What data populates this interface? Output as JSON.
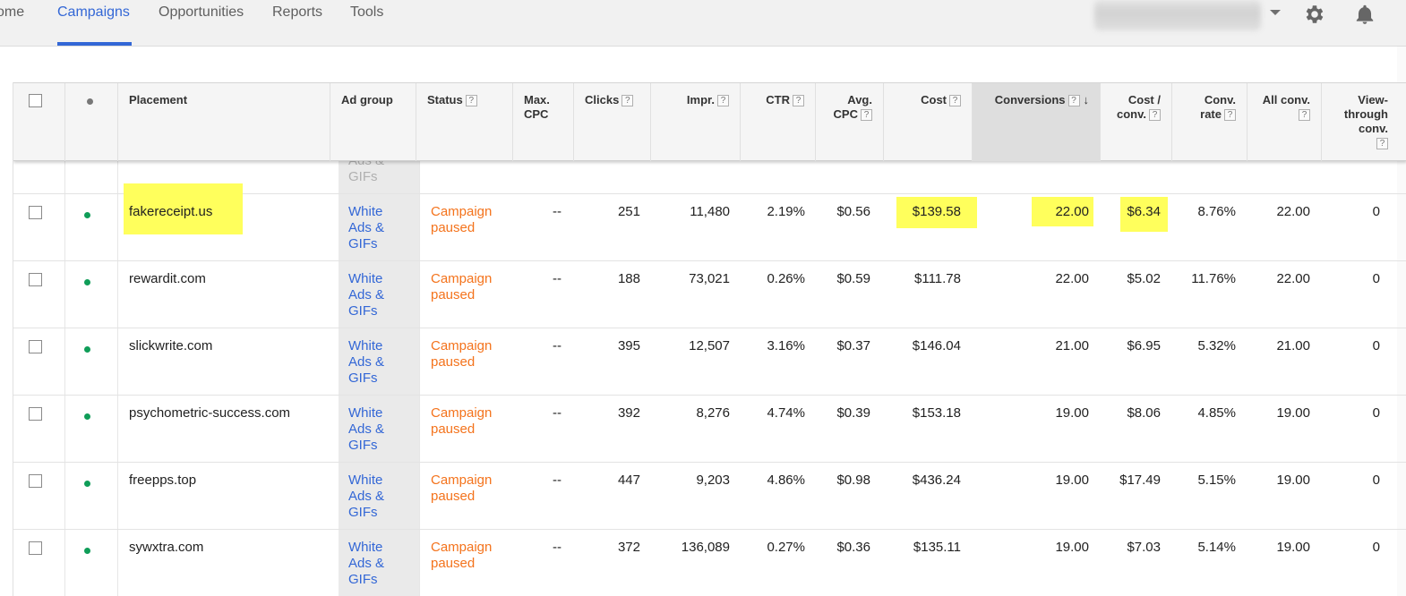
{
  "nav": {
    "items": [
      "ome",
      "Campaigns",
      "Opportunities",
      "Reports",
      "Tools"
    ],
    "active_index": 1
  },
  "icons": {
    "settings": "gear-icon",
    "notifications": "bell-icon",
    "account_menu": "caret-down-icon"
  },
  "colors": {
    "accent": "#3367d6",
    "status_paused": "#f4731c",
    "status_dot": "#0f9d58",
    "highlight": "#ffff5c"
  },
  "table": {
    "headers": {
      "placement": "Placement",
      "ad_group": "Ad group",
      "status": "Status",
      "max_cpc": [
        "Max.",
        "CPC"
      ],
      "clicks": "Clicks",
      "impr": "Impr.",
      "ctr": "CTR",
      "avg_cpc": [
        "Avg.",
        "CPC"
      ],
      "cost": "Cost",
      "conversions": "Conversions",
      "cost_per_conv": [
        "Cost /",
        "conv."
      ],
      "conv_rate": [
        "Conv.",
        "rate"
      ],
      "all_conv": "All conv.",
      "view_through": [
        "View-",
        "through",
        "conv."
      ]
    },
    "help_glyph": "?",
    "sort_glyph": "↓",
    "partial_row": [
      "Ads &",
      "GIFs"
    ],
    "rows": [
      {
        "placement": "fakereceipt.us",
        "ad_group": [
          "White",
          "Ads &",
          "GIFs"
        ],
        "status": [
          "Campaign",
          "paused"
        ],
        "max_cpc": "--",
        "clicks": "251",
        "impr": "11,480",
        "ctr": "2.19%",
        "avg_cpc": "$0.56",
        "cost": "$139.58",
        "conversions": "22.00",
        "cost_per_conv": "$6.34",
        "conv_rate": "8.76%",
        "all_conv": "22.00",
        "view_through": "0"
      },
      {
        "placement": "rewardit.com",
        "ad_group": [
          "White",
          "Ads &",
          "GIFs"
        ],
        "status": [
          "Campaign",
          "paused"
        ],
        "max_cpc": "--",
        "clicks": "188",
        "impr": "73,021",
        "ctr": "0.26%",
        "avg_cpc": "$0.59",
        "cost": "$111.78",
        "conversions": "22.00",
        "cost_per_conv": "$5.02",
        "conv_rate": "11.76%",
        "all_conv": "22.00",
        "view_through": "0"
      },
      {
        "placement": "slickwrite.com",
        "ad_group": [
          "White",
          "Ads &",
          "GIFs"
        ],
        "status": [
          "Campaign",
          "paused"
        ],
        "max_cpc": "--",
        "clicks": "395",
        "impr": "12,507",
        "ctr": "3.16%",
        "avg_cpc": "$0.37",
        "cost": "$146.04",
        "conversions": "21.00",
        "cost_per_conv": "$6.95",
        "conv_rate": "5.32%",
        "all_conv": "21.00",
        "view_through": "0"
      },
      {
        "placement": "psychometric-success.com",
        "ad_group": [
          "White",
          "Ads &",
          "GIFs"
        ],
        "status": [
          "Campaign",
          "paused"
        ],
        "max_cpc": "--",
        "clicks": "392",
        "impr": "8,276",
        "ctr": "4.74%",
        "avg_cpc": "$0.39",
        "cost": "$153.18",
        "conversions": "19.00",
        "cost_per_conv": "$8.06",
        "conv_rate": "4.85%",
        "all_conv": "19.00",
        "view_through": "0"
      },
      {
        "placement": "freepps.top",
        "ad_group": [
          "White",
          "Ads &",
          "GIFs"
        ],
        "status": [
          "Campaign",
          "paused"
        ],
        "max_cpc": "--",
        "clicks": "447",
        "impr": "9,203",
        "ctr": "4.86%",
        "avg_cpc": "$0.98",
        "cost": "$436.24",
        "conversions": "19.00",
        "cost_per_conv": "$17.49",
        "conv_rate": "5.15%",
        "all_conv": "19.00",
        "view_through": "0"
      },
      {
        "placement": "sywxtra.com",
        "ad_group": [
          "White",
          "Ads &",
          "GIFs"
        ],
        "status": [
          "Campaign",
          "paused"
        ],
        "max_cpc": "--",
        "clicks": "372",
        "impr": "136,089",
        "ctr": "0.27%",
        "avg_cpc": "$0.36",
        "cost": "$135.11",
        "conversions": "19.00",
        "cost_per_conv": "$7.03",
        "conv_rate": "5.14%",
        "all_conv": "19.00",
        "view_through": "0"
      }
    ]
  }
}
